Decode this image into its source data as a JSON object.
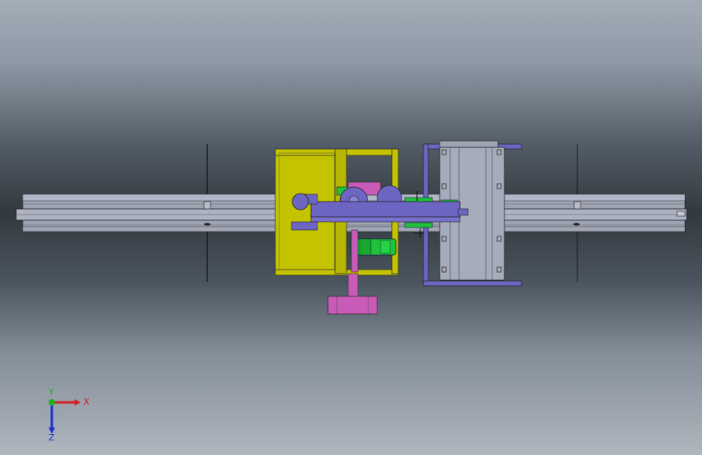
{
  "triad": {
    "x_label": "X",
    "y_label": "Y",
    "z_label": "Z"
  },
  "colors": {
    "background_top": "#a3adb8",
    "background_mid": "#323940",
    "rail": "#a9aebc",
    "frame_yellow": "#c2c100",
    "carriage_blue": "#6a64c0",
    "gear_green": "#1fc23a",
    "arm_magenta": "#c85ab8",
    "axis_x": "#d62020",
    "axis_y": "#20b020",
    "axis_z": "#2030d0"
  },
  "icons": {
    "view_triad": "xyz-triad-icon"
  }
}
